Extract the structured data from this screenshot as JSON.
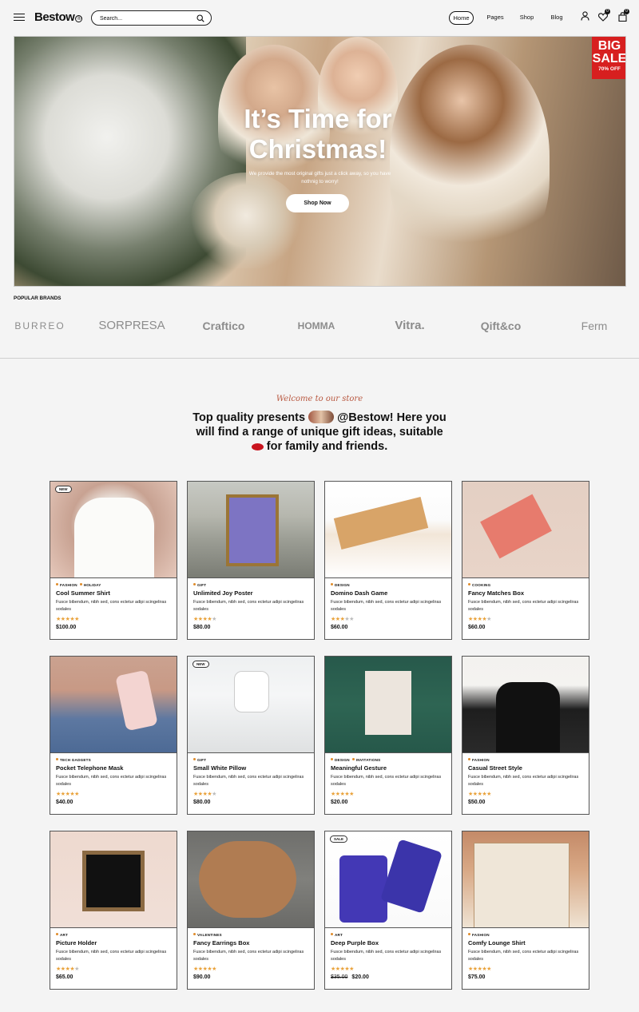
{
  "header": {
    "logo": "Bestow",
    "logo_mark": "®",
    "search_placeholder": "Search...",
    "nav": [
      "Home",
      "Pages",
      "Shop",
      "Blog"
    ],
    "active_nav": "Home",
    "wishlist_count": "0",
    "cart_count": "0",
    "icons": [
      "menu-icon",
      "search-icon",
      "user-icon",
      "heart-icon",
      "bag-icon"
    ]
  },
  "hero": {
    "title_line1": "It’s Time for",
    "title_line2": "Christmas!",
    "subtitle": "We provide the most original gifts just a click away, so you have nothnig to worry!",
    "cta": "Shop Now",
    "sale_badge": {
      "line1": "BIG",
      "line2": "SALE",
      "line3": "70% OFF"
    }
  },
  "brands": {
    "title": "POPULAR BRANDS",
    "items": [
      "BURREO",
      "SORPRESA",
      "Craftico",
      "HOMMA",
      "Vitra.",
      "Qift&co",
      "Ferm"
    ]
  },
  "intro": {
    "script": "Welcome to our store",
    "part1": "Top quality presents",
    "part2": "@Bestow! Here you will find a range of unique gift ideas, suitable",
    "part3": "for family and friends."
  },
  "products": [
    {
      "cats": [
        "FASHION",
        "HOLIDAY"
      ],
      "name": "Cool Summer Shirt",
      "desc": "Fusce bibendum, nibh sed, cons ectetur adipi scingeliras sodales",
      "rating": 5,
      "price": "$100.00",
      "tag": "NEW"
    },
    {
      "cats": [
        "GIFT"
      ],
      "name": "Unlimited Joy Poster",
      "desc": "Fusce bibendum, nibh sed, cons ectetur adipi scingeliras sodales",
      "rating": 4,
      "price": "$80.00"
    },
    {
      "cats": [
        "DESIGN"
      ],
      "name": "Domino Dash Game",
      "desc": "Fusce bibendum, nibh sed, cons ectetur adipi scingeliras sodales",
      "rating": 3,
      "price": "$60.00"
    },
    {
      "cats": [
        "COOKING"
      ],
      "name": "Fancy Matches Box",
      "desc": "Fusce bibendum, nibh sed, cons ectetur adipi scingeliras sodales",
      "rating": 4,
      "price": "$60.00"
    },
    {
      "cats": [
        "TECH GADGETS"
      ],
      "name": "Pocket Telephone Mask",
      "desc": "Fusce bibendum, nibh sed, cons ectetur adipi scingeliras sodales",
      "rating": 5,
      "price": "$40.00"
    },
    {
      "cats": [
        "GIFT"
      ],
      "name": "Small White Pillow",
      "desc": "Fusce bibendum, nibh sed, cons ectetur adipi scingeliras sodales",
      "rating": 4,
      "price": "$80.00",
      "tag": "NEW"
    },
    {
      "cats": [
        "DESIGN",
        "INVITATIONS"
      ],
      "name": "Meaningful Gesture",
      "desc": "Fusce bibendum, nibh sed, cons ectetur adipi scingeliras sodales",
      "rating": 5,
      "price": "$20.00"
    },
    {
      "cats": [
        "FASHION"
      ],
      "name": "Casual Street Style",
      "desc": "Fusce bibendum, nibh sed, cons ectetur adipi scingeliras sodales",
      "rating": 5,
      "price": "$50.00"
    },
    {
      "cats": [
        "ART"
      ],
      "name": "Picture Holder",
      "desc": "Fusce bibendum, nibh sed, cons ectetur adipi scingeliras sodales",
      "rating": 4,
      "price": "$65.00"
    },
    {
      "cats": [
        "VALENTINES"
      ],
      "name": "Fancy Earrings Box",
      "desc": "Fusce bibendum, nibh sed, cons ectetur adipi scingeliras sodales",
      "rating": 5,
      "price": "$90.00"
    },
    {
      "cats": [
        "ART"
      ],
      "name": "Deep Purple Box",
      "desc": "Fusce bibendum, nibh sed, cons ectetur adipi scingeliras sodales",
      "rating": 5,
      "price": "$20.00",
      "old_price": "$35.00",
      "tag": "SALE"
    },
    {
      "cats": [
        "FASHION"
      ],
      "name": "Comfy Lounge Shirt",
      "desc": "Fusce bibendum, nibh sed, cons ectetur adipi scingeliras sodales",
      "rating": 5,
      "price": "$75.00"
    }
  ]
}
